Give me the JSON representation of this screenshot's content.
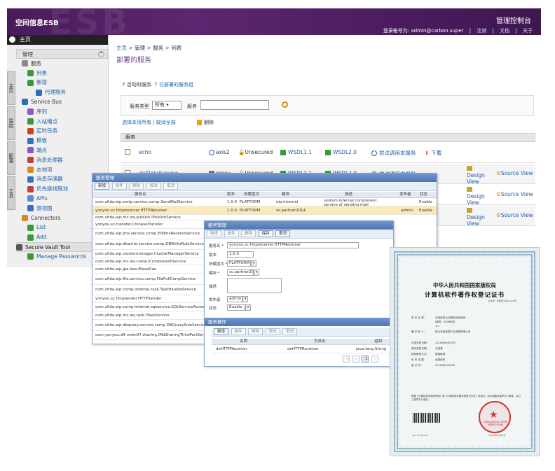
{
  "header": {
    "brand": "空间信息ESB",
    "title": "管理控制台",
    "user_label": "登录帐号为: admin@carbon.super",
    "links": [
      "注销",
      "文档",
      "关于"
    ]
  },
  "sidebar": {
    "home": "主页",
    "manage": "管理",
    "vtabs": [
      "主页",
      "监控",
      "配置",
      "工具"
    ],
    "items": [
      {
        "label": "服务",
        "level": "l1"
      },
      {
        "label": "列表",
        "level": "l2"
      },
      {
        "label": "新增",
        "level": "l2"
      },
      {
        "label": "代理服务",
        "level": "l3"
      },
      {
        "label": "Service Bus",
        "level": "l1"
      },
      {
        "label": "序列",
        "level": "l2"
      },
      {
        "label": "入站端点",
        "level": "l2"
      },
      {
        "label": "定时任务",
        "level": "l2"
      },
      {
        "label": "模板",
        "level": "l2"
      },
      {
        "label": "端点",
        "level": "l2"
      },
      {
        "label": "消息处理器",
        "level": "l2"
      },
      {
        "label": "本地项",
        "level": "l2"
      },
      {
        "label": "消息存储器",
        "level": "l2"
      },
      {
        "label": "优先级线程池",
        "level": "l2"
      },
      {
        "label": "APIs",
        "level": "l2"
      },
      {
        "label": "源视图",
        "level": "l2"
      },
      {
        "label": "Connectors",
        "level": "l1"
      },
      {
        "label": "List",
        "level": "l2"
      },
      {
        "label": "Add",
        "level": "l2"
      },
      {
        "label": "Secure Vault Tool",
        "level": "section"
      },
      {
        "label": "Manage Passwords",
        "level": "l2"
      }
    ]
  },
  "content": {
    "breadcrumb": [
      "主页",
      "管理",
      "服务",
      "列表"
    ],
    "page_title": "部署的服务",
    "summary_count": "7 活动的服务.",
    "summary_link": "7 已部署的服务组",
    "filter": {
      "type_label": "服务类型",
      "type_value": "所有",
      "service_label": "服务"
    },
    "select_all": "选择本页所有",
    "clear_all": "取消全部",
    "delete_label": "删除",
    "table_header": "服务",
    "rows": [
      {
        "name": "echo",
        "type": "axis2",
        "security": "Unsecured",
        "wsdl1": "WSDL1.1",
        "wsdl2": "WSDL2.0",
        "try": "尝试调用本服务",
        "extra": "下载"
      },
      {
        "name": "gisDataService",
        "type": "proxy",
        "security": "Unsecured",
        "wsdl1": "WSDL1.1",
        "wsdl2": "WSDL2.0",
        "try": "尝试调用本服务",
        "design": "Design View",
        "source": "Source View"
      }
    ],
    "extra_actions": [
      {
        "design": "Design View",
        "source": "Source View"
      },
      {
        "design": "Design View",
        "source": "Source View"
      }
    ]
  },
  "win1": {
    "title": "服务管理",
    "toolbar": [
      "新增",
      "组件",
      "删除",
      "修改",
      "取消"
    ],
    "columns": [
      "服务名",
      "版本",
      "所属层次",
      "模块",
      "描述",
      "发布者",
      "状态"
    ],
    "rows": [
      {
        "name": "com.ufida.eip.smtp.service.comp.SendMailService",
        "ver": "1.0.0",
        "layer": "PLATFORM",
        "module": "eip.internal",
        "desc": "system internal component service of sending mail",
        "pub": "",
        "status": "Enable"
      },
      {
        "name": "yonyou.sc.httpreceiver.HTTPReceiver",
        "ver": "1.0.0",
        "layer": "PLATFORM",
        "module": "sc.partner2014",
        "desc": "",
        "pub": "admin",
        "status": "Enable"
      },
      {
        "name": "com.ufida.eip.mc.ws.publish.IPublishService",
        "ver": "",
        "layer": "",
        "module": "",
        "desc": "",
        "pub": "",
        "status": ""
      },
      {
        "name": "yonyou.sc.transfer.ChineseTransfer",
        "ver": "",
        "layer": "",
        "module": "",
        "desc": "",
        "pub": "",
        "status": ""
      },
      {
        "name": "com.ufida.eip.jms.service.comp.EIPJmsReceiveService",
        "ver": "",
        "layer": "",
        "module": "",
        "desc": "",
        "pub": "",
        "status": ""
      },
      {
        "name": "com.ufida.eip.dbwrite.service.comp.DBWriteRuleService",
        "ver": "",
        "layer": "",
        "module": "",
        "desc": "",
        "pub": "",
        "status": ""
      },
      {
        "name": "com.ufida.eip.clustermanager.ClusterManagerService",
        "ver": "",
        "layer": "",
        "module": "",
        "desc": "",
        "pub": "",
        "status": ""
      },
      {
        "name": "com.ufida.eip.mc.ws.comp.IComponentService",
        "ver": "",
        "layer": "",
        "module": "",
        "desc": "",
        "pub": "",
        "status": ""
      },
      {
        "name": "com.ufida.eip.jpa.dao.IBaseDao",
        "ver": "",
        "layer": "",
        "module": "",
        "desc": "",
        "pub": "",
        "status": ""
      },
      {
        "name": "com.ufida.eip.file.service.comp.FilePullCompService",
        "ver": "",
        "layer": "",
        "module": "",
        "desc": "",
        "pub": "",
        "status": ""
      },
      {
        "name": "com.ufida.eip.comp.internal.task.TaskHandleService",
        "ver": "",
        "layer": "",
        "module": "",
        "desc": "",
        "pub": "",
        "status": ""
      },
      {
        "name": "yonyou.sc.httpsender.HTTPSender",
        "ver": "",
        "layer": "",
        "module": "",
        "desc": "",
        "pub": "",
        "status": ""
      },
      {
        "name": "com.ufida.eip.comp.internal.sqlservice.SQLServiceAccess",
        "ver": "",
        "layer": "",
        "module": "",
        "desc": "",
        "pub": "",
        "status": ""
      },
      {
        "name": "com.ufida.eip.mc.ws.task.ITaskService",
        "ver": "",
        "layer": "",
        "module": "",
        "desc": "",
        "pub": "",
        "status": ""
      },
      {
        "name": "com.ufida.eip.dbquery.service.comp.DBQueryRuleService",
        "ver": "",
        "layer": "",
        "module": "",
        "desc": "",
        "pub": "",
        "status": ""
      },
      {
        "name": "com.yonyou.dff.mdm07.sharing.IMdSharingThirdPartService",
        "ver": "",
        "layer": "",
        "module": "",
        "desc": "",
        "pub": "",
        "status": ""
      }
    ]
  },
  "win2": {
    "title": "服务管理",
    "toolbar": [
      "新增",
      "组件",
      "删除",
      "保存",
      "取消"
    ],
    "fields": [
      {
        "label": "服务名 *",
        "value": "yonyou.sc.httpreceiver.HTTPReceiver"
      },
      {
        "label": "版本",
        "value": "1.0.0"
      },
      {
        "label": "所属层次 *",
        "value": "PLATFORM"
      },
      {
        "label": "模块 *",
        "value": "sc.partner2014"
      },
      {
        "label": "描述",
        "value": ""
      },
      {
        "label": "发布者",
        "value": "admin"
      },
      {
        "label": "状态",
        "value": "Enable"
      }
    ],
    "sub_title": "服务操作",
    "sub_toolbar": [
      "新增",
      "组件",
      "删除",
      "修改",
      "取消"
    ],
    "sub_columns": [
      "名称",
      "方法名",
      "返回"
    ],
    "sub_rows": [
      {
        "name": "doHTTPReceiver",
        "method": "doHTTPReceiver",
        "ret": "java.lang.String"
      }
    ],
    "pager_page": "1"
  },
  "certificate": {
    "heading1": "中华人民共和国国家版权局",
    "heading2": "计算机软件著作权登记证书",
    "number": "证书号：软著登字第0XXXX号",
    "lines": [
      {
        "k": "软 件 名 称：",
        "v": "空间信息企业服务总线系统"
      },
      {
        "k": "",
        "v": "[简称：ESB系统]"
      },
      {
        "k": "",
        "v": "1.0"
      },
      {
        "k": "著 作 权 人：",
        "v": "四川空间信息产业发展有限公司"
      },
      {
        "k": "开发完成日期：",
        "v": "2016年08月01日"
      },
      {
        "k": "首次发表日期：",
        "v": "未发表"
      },
      {
        "k": "权利取得方式：",
        "v": "原始取得"
      },
      {
        "k": "权 利 范 围：",
        "v": "全部权利"
      },
      {
        "k": "登 记 号：",
        "v": "2016SR332858"
      }
    ],
    "paragraph": "根据《计算机软件保护条例》和《计算机软件著作权登记办法》的规定，经中国版权保护中心审核，对以上事项予以登记。",
    "seal_text": "中国版权保护中心 软件著作权登记专用章",
    "footer_no": "No. 01XXXXXX",
    "date": "2016年11月XX日"
  },
  "colors": {
    "header_purple": "#4a1b5a",
    "link_blue": "#1f5fa8",
    "window_title_blue": "#4d76b3",
    "selected_row": "#fbe9b8",
    "seal_red": "#d3312e"
  }
}
